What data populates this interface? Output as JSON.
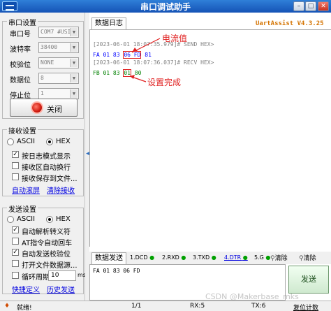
{
  "window": {
    "title": "串口调试助手",
    "brand": "UartAssist V4.3.25",
    "min_label": "–",
    "max_label": "□",
    "close_label": "✕"
  },
  "serial_settings": {
    "title": "串口设置",
    "rows": [
      {
        "label": "串口号",
        "value": "COM7 #USI"
      },
      {
        "label": "波特率",
        "value": "38400"
      },
      {
        "label": "校验位",
        "value": "NONE"
      },
      {
        "label": "数据位",
        "value": "8"
      },
      {
        "label": "停止位",
        "value": "1"
      }
    ],
    "close_button": "关闭"
  },
  "receive_settings": {
    "title": "接收设置",
    "ascii_label": "ASCII",
    "hex_label": "HEX",
    "options": [
      {
        "label": "按日志模式显示",
        "checked": true
      },
      {
        "label": "接收区自动换行",
        "checked": false
      },
      {
        "label": "接收保存到文件...",
        "checked": false
      }
    ],
    "auto_scroll_link": "自动滚屏",
    "clear_link": "清除接收"
  },
  "send_settings": {
    "title": "发送设置",
    "ascii_label": "ASCII",
    "hex_label": "HEX",
    "options": [
      {
        "label": "自动解析转义符",
        "checked": true
      },
      {
        "label": "AT指令自动回车",
        "checked": false
      },
      {
        "label": "自动发送校验位",
        "checked": true
      },
      {
        "label": "打开文件数据源...",
        "checked": false
      },
      {
        "label": "循环周期",
        "checked": false
      }
    ],
    "period_value": "10",
    "period_unit": "ms",
    "shortcut_link": "快捷定义",
    "history_link": "历史发送"
  },
  "log_tab": "数据日志",
  "log": {
    "line1_ts": "[2023-06-01 18:07:35.979]# SEND HEX>",
    "line1_pre": "FA 01 83 ",
    "line1_box": "06 FD",
    "line1_post": " 81",
    "line2_ts": "[2023-06-01 18:07:36.037]# RECV HEX>",
    "line2_pre": "FB 01 83 ",
    "line2_box": "01",
    "line2_post": " 80"
  },
  "annotations": {
    "current": "电流值",
    "done": "设置完成"
  },
  "send_bar": {
    "tab": "数据发送",
    "indicators": [
      {
        "label": "1.DCD",
        "color": "#00a000"
      },
      {
        "label": "2.RXD",
        "color": "#00a000"
      },
      {
        "label": "3.TXD",
        "color": "#00a000"
      },
      {
        "label": "4.DTR",
        "color": "#00a000"
      },
      {
        "label": "5.G",
        "color": "#00a000"
      }
    ],
    "clear1": "清除",
    "clear2": "清除"
  },
  "send_text": "FA 01 83 06 FD",
  "send_button": "发送",
  "status": {
    "ready": "就绪!",
    "page": "1/1",
    "rx": "RX:5",
    "tx": "TX:6",
    "reset": "复位计数"
  },
  "watermark": "CSDN @Makerbase_mks",
  "colors": {
    "titlebar": "#1553b6",
    "send_text": "#0000ff",
    "recv_text": "#008000",
    "annotation": "#e02020",
    "brand": "#d47300"
  }
}
